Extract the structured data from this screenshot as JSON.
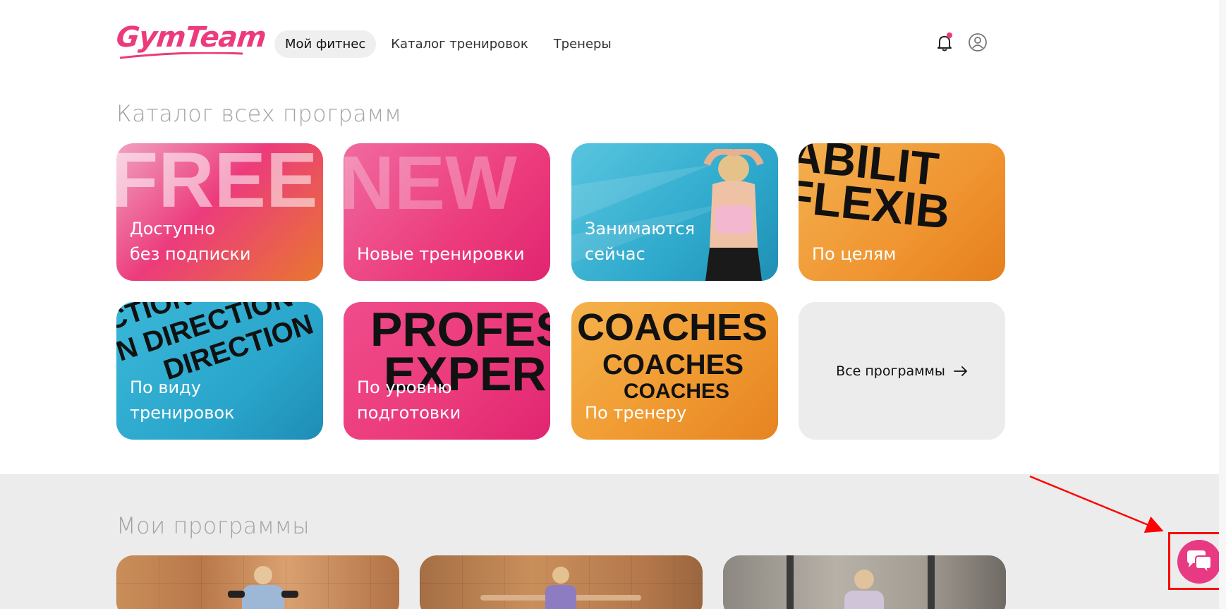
{
  "header": {
    "logo": "GymTeam",
    "nav": [
      {
        "label": "Мой фитнес",
        "active": true
      },
      {
        "label": "Каталог тренировок",
        "active": false
      },
      {
        "label": "Тренеры",
        "active": false
      }
    ],
    "icons": [
      "bell-icon",
      "user-icon"
    ]
  },
  "catalog": {
    "title": "Каталог всех программ",
    "cards": [
      {
        "label": "Доступно\nбез подписки",
        "bg_text": "FREE"
      },
      {
        "label": "Новые тренировки",
        "bg_text": "NEW"
      },
      {
        "label": "Занимаются\nсейчас"
      },
      {
        "label": "По целям",
        "bg_text": "FLEXIBILITY"
      },
      {
        "label": "По виду\nтренировок",
        "bg_text": "DIRECTION"
      },
      {
        "label": "По уровню\nподготовки",
        "bg_text": "PROFES EXPER"
      },
      {
        "label": "По тренеру",
        "bg_text": "COACHES"
      }
    ],
    "all_programs": "Все программы"
  },
  "my_programs": {
    "title": "Мои программы"
  },
  "colors": {
    "brand": "#ec3b7c",
    "annotation": "#ff0000"
  }
}
